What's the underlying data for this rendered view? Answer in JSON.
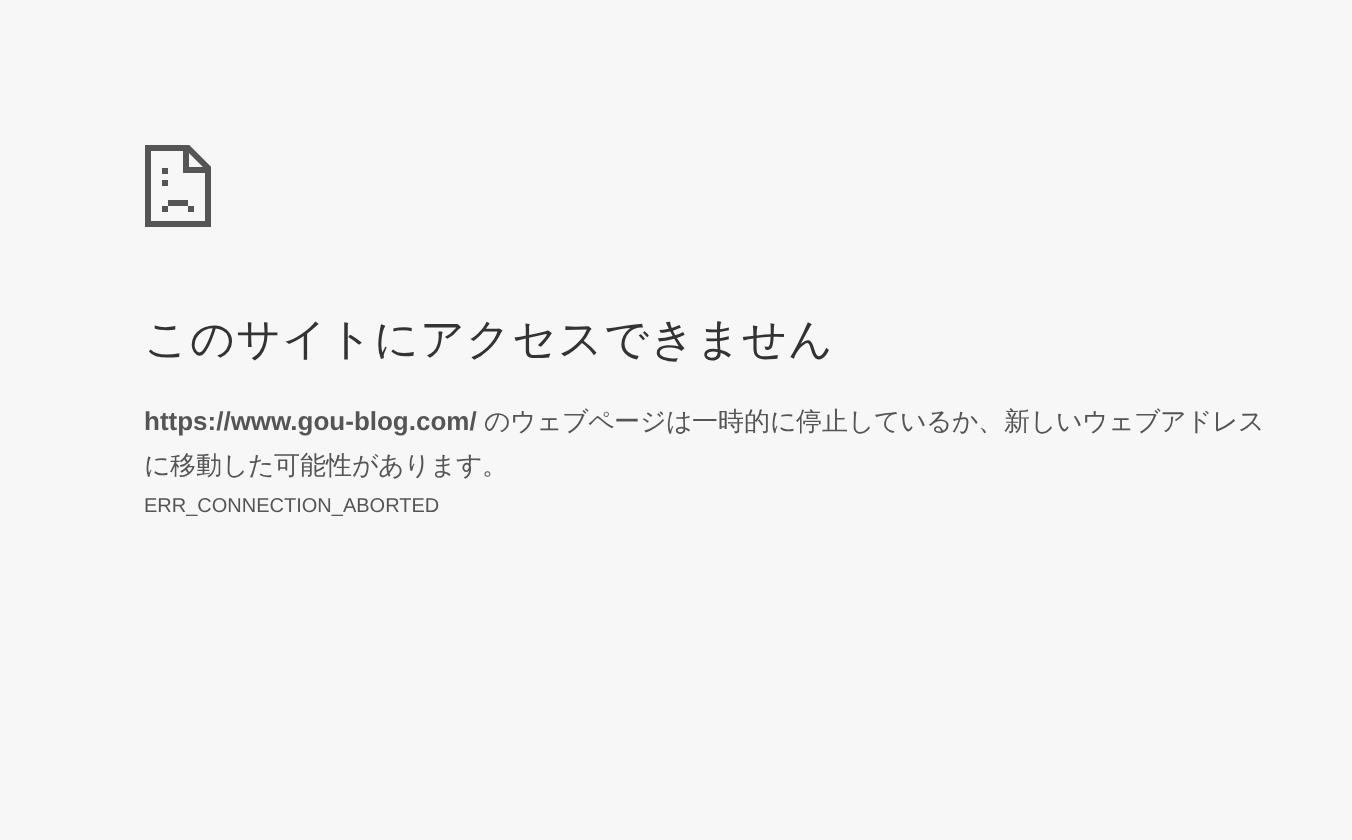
{
  "heading": "このサイトにアクセスできません",
  "message": "**https://www.gou-blog.com/** のウェブページは一時的に停止しているか、新しいウェブアドレスに移動した可能性があります。",
  "error_code": "ERR_CONNECTION_ABORTED"
}
